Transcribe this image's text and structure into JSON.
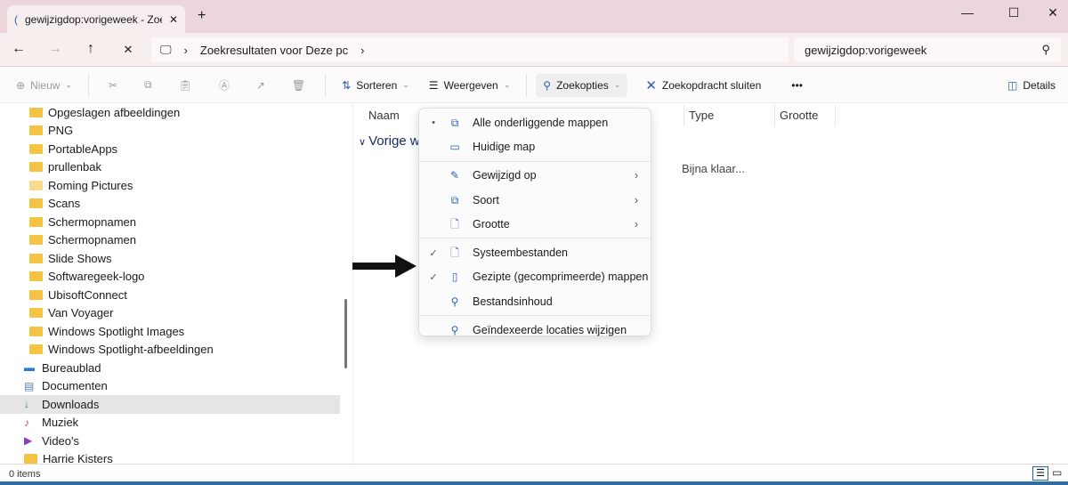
{
  "window": {
    "tab_title": "gewijzigdop:vorigeweek - Zoel",
    "new_tab": "+",
    "minimize": "—",
    "maximize": "☐",
    "close": "✕"
  },
  "nav": {
    "back": "←",
    "forward": "→",
    "up": "↑",
    "stop": "✕"
  },
  "address": {
    "segments": [
      "Zoekresultaten voor Deze pc"
    ],
    "search_value": "gewijzigdop:vorigeweek"
  },
  "toolbar": {
    "new": "Nieuw",
    "sort": "Sorteren",
    "view": "Weergeven",
    "search_options": "Zoekopties",
    "close_search": "Zoekopdracht sluiten",
    "more": "•••",
    "details": "Details"
  },
  "sidebar": {
    "items": [
      {
        "label": "Opgeslagen afbeeldingen",
        "icon": "folder"
      },
      {
        "label": "PNG",
        "icon": "folder"
      },
      {
        "label": "PortableApps",
        "icon": "folder"
      },
      {
        "label": "prullenbak",
        "icon": "folder"
      },
      {
        "label": "Roming Pictures",
        "icon": "folder-light"
      },
      {
        "label": "Scans",
        "icon": "folder"
      },
      {
        "label": "Schermopnamen",
        "icon": "folder"
      },
      {
        "label": "Schermopnamen",
        "icon": "folder"
      },
      {
        "label": "Slide Shows",
        "icon": "folder"
      },
      {
        "label": "Softwaregeek-logo",
        "icon": "folder"
      },
      {
        "label": "UbisoftConnect",
        "icon": "folder"
      },
      {
        "label": "Van Voyager",
        "icon": "folder"
      },
      {
        "label": "Windows Spotlight Images",
        "icon": "folder"
      },
      {
        "label": "Windows Spotlight-afbeeldingen",
        "icon": "folder"
      },
      {
        "label": "Bureaublad",
        "icon": "desktop"
      },
      {
        "label": "Documenten",
        "icon": "documents"
      },
      {
        "label": "Downloads",
        "icon": "download",
        "selected": true
      },
      {
        "label": "Muziek",
        "icon": "music"
      },
      {
        "label": "Video's",
        "icon": "video"
      },
      {
        "label": "Harrie Kisters",
        "icon": "folder"
      }
    ]
  },
  "content": {
    "columns": [
      "Naam",
      "Type",
      "Grootte"
    ],
    "group": "Vorige w",
    "status_loading": "Bijna klaar..."
  },
  "menu": {
    "items": [
      {
        "label": "Alle onderliggende mappen",
        "mark": "•"
      },
      {
        "label": "Huidige map",
        "mark": ""
      },
      {
        "label": "Gewijzigd op",
        "submenu": true
      },
      {
        "label": "Soort",
        "submenu": true
      },
      {
        "label": "Grootte",
        "submenu": true
      },
      {
        "label": "Systeembestanden",
        "mark": "✓"
      },
      {
        "label": "Gezipte (gecomprimeerde) mappen",
        "mark": "✓"
      },
      {
        "label": "Bestandsinhoud",
        "mark": ""
      },
      {
        "label": "Geïndexeerde locaties wijzigen"
      }
    ]
  },
  "statusbar": {
    "items": "0 items"
  },
  "colors": {
    "accent": "#2b5fb3",
    "titlebar": "#ecd6dc",
    "folder": "#f4c343"
  }
}
